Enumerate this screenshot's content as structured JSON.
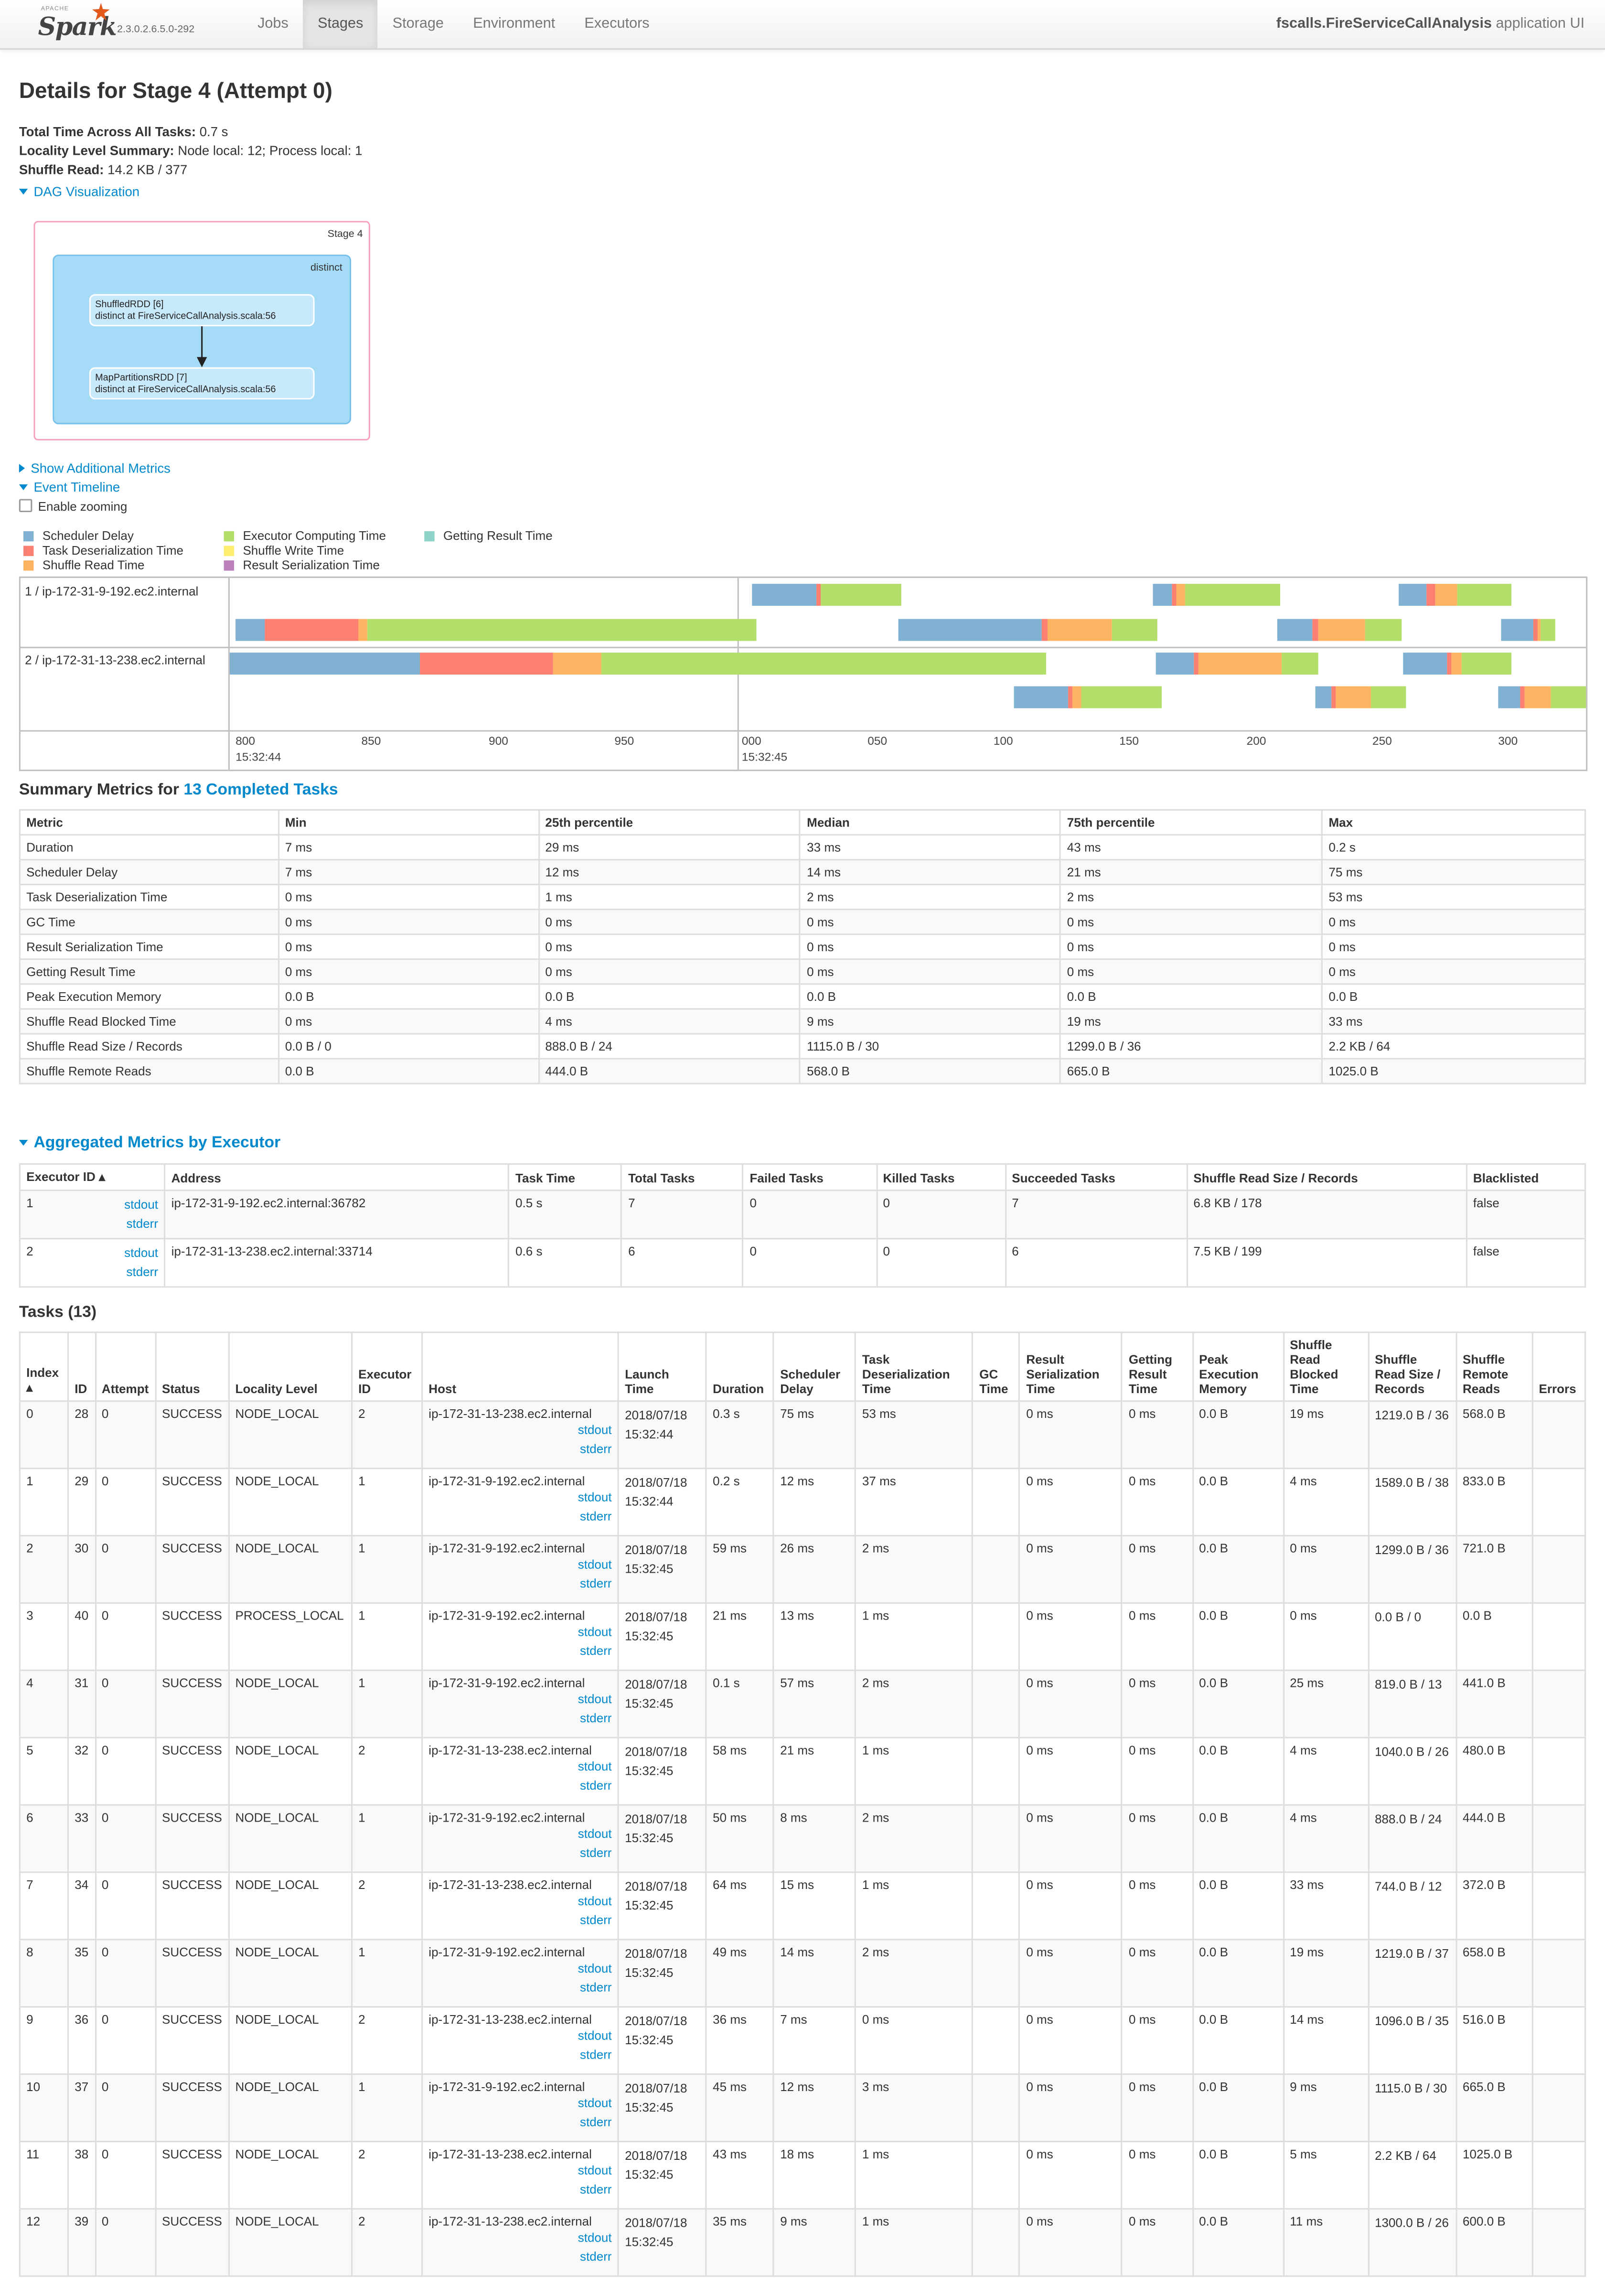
{
  "nav": {
    "logo_word": "Spark",
    "logo_apache": "APACHE",
    "version": "2.3.0.2.6.5.0-292",
    "tabs": [
      "Jobs",
      "Stages",
      "Storage",
      "Environment",
      "Executors"
    ],
    "active_tab": "Stages",
    "app_name": "fscalls.FireServiceCallAnalysis",
    "app_suffix": " application UI"
  },
  "page": {
    "title": "Details for Stage 4 (Attempt 0)",
    "total_time_label": "Total Time Across All Tasks:",
    "total_time_value": " 0.7 s",
    "locality_label": "Locality Level Summary:",
    "locality_value": " Node local: 12; Process local: 1",
    "shuffle_read_label": "Shuffle Read:",
    "shuffle_read_value": " 14.2 KB / 377",
    "dag_toggle": "DAG Visualization",
    "additional_metrics_toggle": "Show Additional Metrics",
    "event_timeline_toggle": "Event Timeline",
    "enable_zooming": "Enable zooming"
  },
  "dag": {
    "stage_label": "Stage 4",
    "cluster_label": "distinct",
    "node1_line1": "ShuffledRDD [6]",
    "node1_line2": "distinct at FireServiceCallAnalysis.scala:56",
    "node2_line1": "MapPartitionsRDD [7]",
    "node2_line2": "distinct at FireServiceCallAnalysis.scala:56"
  },
  "timeline": {
    "legend": [
      {
        "label": "Scheduler Delay",
        "color": "#80b1d3"
      },
      {
        "label": "Task Deserialization Time",
        "color": "#fb8072"
      },
      {
        "label": "Shuffle Read Time",
        "color": "#fdb462"
      },
      {
        "label": "Executor Computing Time",
        "color": "#b3de69"
      },
      {
        "label": "Shuffle Write Time",
        "color": "#ffed6f"
      },
      {
        "label": "Result Serialization Time",
        "color": "#bc80bd"
      },
      {
        "label": "Getting Result Time",
        "color": "#8dd3c7"
      }
    ],
    "groups": [
      "1 / ip-172-31-9-192.ec2.internal",
      "2 / ip-172-31-13-238.ec2.internal"
    ],
    "ticks": [
      "800",
      "850",
      "900",
      "950",
      "000",
      "050",
      "100",
      "150",
      "200",
      "250",
      "300"
    ],
    "tick_dates": [
      "15:32:44",
      "15:32:45"
    ]
  },
  "summary": {
    "title_prefix": "Summary Metrics for ",
    "title_link": "13 Completed Tasks",
    "headers": [
      "Metric",
      "Min",
      "25th percentile",
      "Median",
      "75th percentile",
      "Max"
    ],
    "rows": [
      [
        "Duration",
        "7 ms",
        "29 ms",
        "33 ms",
        "43 ms",
        "0.2 s"
      ],
      [
        "Scheduler Delay",
        "7 ms",
        "12 ms",
        "14 ms",
        "21 ms",
        "75 ms"
      ],
      [
        "Task Deserialization Time",
        "0 ms",
        "1 ms",
        "2 ms",
        "2 ms",
        "53 ms"
      ],
      [
        "GC Time",
        "0 ms",
        "0 ms",
        "0 ms",
        "0 ms",
        "0 ms"
      ],
      [
        "Result Serialization Time",
        "0 ms",
        "0 ms",
        "0 ms",
        "0 ms",
        "0 ms"
      ],
      [
        "Getting Result Time",
        "0 ms",
        "0 ms",
        "0 ms",
        "0 ms",
        "0 ms"
      ],
      [
        "Peak Execution Memory",
        "0.0 B",
        "0.0 B",
        "0.0 B",
        "0.0 B",
        "0.0 B"
      ],
      [
        "Shuffle Read Blocked Time",
        "0 ms",
        "4 ms",
        "9 ms",
        "19 ms",
        "33 ms"
      ],
      [
        "Shuffle Read Size / Records",
        "0.0 B / 0",
        "888.0 B / 24",
        "1115.0 B / 30",
        "1299.0 B / 36",
        "2.2 KB / 64"
      ],
      [
        "Shuffle Remote Reads",
        "0.0 B",
        "444.0 B",
        "568.0 B",
        "665.0 B",
        "1025.0 B"
      ]
    ]
  },
  "executors": {
    "title": "Aggregated Metrics by Executor",
    "headers": [
      "Executor ID ▴",
      "Address",
      "Task Time",
      "Total Tasks",
      "Failed Tasks",
      "Killed Tasks",
      "Succeeded Tasks",
      "Shuffle Read Size / Records",
      "Blacklisted"
    ],
    "rows": [
      {
        "id": "1",
        "stdout": "stdout",
        "stderr": "stderr",
        "address": "ip-172-31-9-192.ec2.internal:36782",
        "task_time": "0.5 s",
        "total": "7",
        "failed": "0",
        "killed": "0",
        "succeeded": "7",
        "shuffle": "6.8 KB / 178",
        "blacklisted": "false"
      },
      {
        "id": "2",
        "stdout": "stdout",
        "stderr": "stderr",
        "address": "ip-172-31-13-238.ec2.internal:33714",
        "task_time": "0.6 s",
        "total": "6",
        "failed": "0",
        "killed": "0",
        "succeeded": "6",
        "shuffle": "7.5 KB / 199",
        "blacklisted": "false"
      }
    ]
  },
  "tasks": {
    "title": "Tasks (13)",
    "headers": [
      "Index ▴",
      "ID",
      "Attempt",
      "Status",
      "Locality Level",
      "Executor ID",
      "Host",
      "Launch Time",
      "Duration",
      "Scheduler Delay",
      "Task Deserialization Time",
      "GC Time",
      "Result Serialization Time",
      "Getting Result Time",
      "Peak Execution Memory",
      "Shuffle Read Blocked Time",
      "Shuffle Read Size / Records",
      "Shuffle Remote Reads",
      "Errors"
    ],
    "rows": [
      [
        "0",
        "28",
        "0",
        "SUCCESS",
        "NODE_LOCAL",
        "2",
        "ip-172-31-13-238.ec2.internal",
        "2018/07/18 15:32:44",
        "0.3 s",
        "75 ms",
        "53 ms",
        "",
        "0 ms",
        "0 ms",
        "0.0 B",
        "19 ms",
        "1219.0 B / 36",
        "568.0 B",
        ""
      ],
      [
        "1",
        "29",
        "0",
        "SUCCESS",
        "NODE_LOCAL",
        "1",
        "ip-172-31-9-192.ec2.internal",
        "2018/07/18 15:32:44",
        "0.2 s",
        "12 ms",
        "37 ms",
        "",
        "0 ms",
        "0 ms",
        "0.0 B",
        "4 ms",
        "1589.0 B / 38",
        "833.0 B",
        ""
      ],
      [
        "2",
        "30",
        "0",
        "SUCCESS",
        "NODE_LOCAL",
        "1",
        "ip-172-31-9-192.ec2.internal",
        "2018/07/18 15:32:45",
        "59 ms",
        "26 ms",
        "2 ms",
        "",
        "0 ms",
        "0 ms",
        "0.0 B",
        "0 ms",
        "1299.0 B / 36",
        "721.0 B",
        ""
      ],
      [
        "3",
        "40",
        "0",
        "SUCCESS",
        "PROCESS_LOCAL",
        "1",
        "ip-172-31-9-192.ec2.internal",
        "2018/07/18 15:32:45",
        "21 ms",
        "13 ms",
        "1 ms",
        "",
        "0 ms",
        "0 ms",
        "0.0 B",
        "0 ms",
        "0.0 B / 0",
        "0.0 B",
        ""
      ],
      [
        "4",
        "31",
        "0",
        "SUCCESS",
        "NODE_LOCAL",
        "1",
        "ip-172-31-9-192.ec2.internal",
        "2018/07/18 15:32:45",
        "0.1 s",
        "57 ms",
        "2 ms",
        "",
        "0 ms",
        "0 ms",
        "0.0 B",
        "25 ms",
        "819.0 B / 13",
        "441.0 B",
        ""
      ],
      [
        "5",
        "32",
        "0",
        "SUCCESS",
        "NODE_LOCAL",
        "2",
        "ip-172-31-13-238.ec2.internal",
        "2018/07/18 15:32:45",
        "58 ms",
        "21 ms",
        "1 ms",
        "",
        "0 ms",
        "0 ms",
        "0.0 B",
        "4 ms",
        "1040.0 B / 26",
        "480.0 B",
        ""
      ],
      [
        "6",
        "33",
        "0",
        "SUCCESS",
        "NODE_LOCAL",
        "1",
        "ip-172-31-9-192.ec2.internal",
        "2018/07/18 15:32:45",
        "50 ms",
        "8 ms",
        "2 ms",
        "",
        "0 ms",
        "0 ms",
        "0.0 B",
        "4 ms",
        "888.0 B / 24",
        "444.0 B",
        ""
      ],
      [
        "7",
        "34",
        "0",
        "SUCCESS",
        "NODE_LOCAL",
        "2",
        "ip-172-31-13-238.ec2.internal",
        "2018/07/18 15:32:45",
        "64 ms",
        "15 ms",
        "1 ms",
        "",
        "0 ms",
        "0 ms",
        "0.0 B",
        "33 ms",
        "744.0 B / 12",
        "372.0 B",
        ""
      ],
      [
        "8",
        "35",
        "0",
        "SUCCESS",
        "NODE_LOCAL",
        "1",
        "ip-172-31-9-192.ec2.internal",
        "2018/07/18 15:32:45",
        "49 ms",
        "14 ms",
        "2 ms",
        "",
        "0 ms",
        "0 ms",
        "0.0 B",
        "19 ms",
        "1219.0 B / 37",
        "658.0 B",
        ""
      ],
      [
        "9",
        "36",
        "0",
        "SUCCESS",
        "NODE_LOCAL",
        "2",
        "ip-172-31-13-238.ec2.internal",
        "2018/07/18 15:32:45",
        "36 ms",
        "7 ms",
        "0 ms",
        "",
        "0 ms",
        "0 ms",
        "0.0 B",
        "14 ms",
        "1096.0 B / 35",
        "516.0 B",
        ""
      ],
      [
        "10",
        "37",
        "0",
        "SUCCESS",
        "NODE_LOCAL",
        "1",
        "ip-172-31-9-192.ec2.internal",
        "2018/07/18 15:32:45",
        "45 ms",
        "12 ms",
        "3 ms",
        "",
        "0 ms",
        "0 ms",
        "0.0 B",
        "9 ms",
        "1115.0 B / 30",
        "665.0 B",
        ""
      ],
      [
        "11",
        "38",
        "0",
        "SUCCESS",
        "NODE_LOCAL",
        "2",
        "ip-172-31-13-238.ec2.internal",
        "2018/07/18 15:32:45",
        "43 ms",
        "18 ms",
        "1 ms",
        "",
        "0 ms",
        "0 ms",
        "0.0 B",
        "5 ms",
        "2.2 KB / 64",
        "1025.0 B",
        ""
      ],
      [
        "12",
        "39",
        "0",
        "SUCCESS",
        "NODE_LOCAL",
        "2",
        "ip-172-31-13-238.ec2.internal",
        "2018/07/18 15:32:45",
        "35 ms",
        "9 ms",
        "1 ms",
        "",
        "0 ms",
        "0 ms",
        "0.0 B",
        "11 ms",
        "1300.0 B / 26",
        "600.0 B",
        ""
      ]
    ],
    "log_links": [
      "stdout",
      "stderr"
    ]
  }
}
